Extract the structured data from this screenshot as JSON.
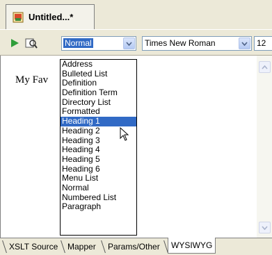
{
  "document_tab": {
    "title": "Untitled...*"
  },
  "toolbar": {
    "style_value": "Normal",
    "font_value": "Times New Roman",
    "size_value": "12"
  },
  "editor": {
    "visible_text": "My Fav"
  },
  "style_dropdown": {
    "options": [
      "Address",
      "Bulleted List",
      "Definition",
      "Definition Term",
      "Directory List",
      "Formatted",
      "Heading 1",
      "Heading 2",
      "Heading 3",
      "Heading 4",
      "Heading 5",
      "Heading 6",
      "Menu List",
      "Normal",
      "Numbered List",
      "Paragraph"
    ],
    "selected": "Heading 1"
  },
  "bottom_tabs": [
    {
      "label": "XSLT Source"
    },
    {
      "label": "Mapper"
    },
    {
      "label": "Params/Other"
    },
    {
      "label": "WYSIWYG"
    }
  ],
  "colors": {
    "selection": "#316ac5",
    "chrome": "#ece9d8"
  },
  "icons": [
    "document-icon",
    "play-icon",
    "search-icon",
    "chevron-down-icon",
    "pointer-cursor-icon"
  ]
}
